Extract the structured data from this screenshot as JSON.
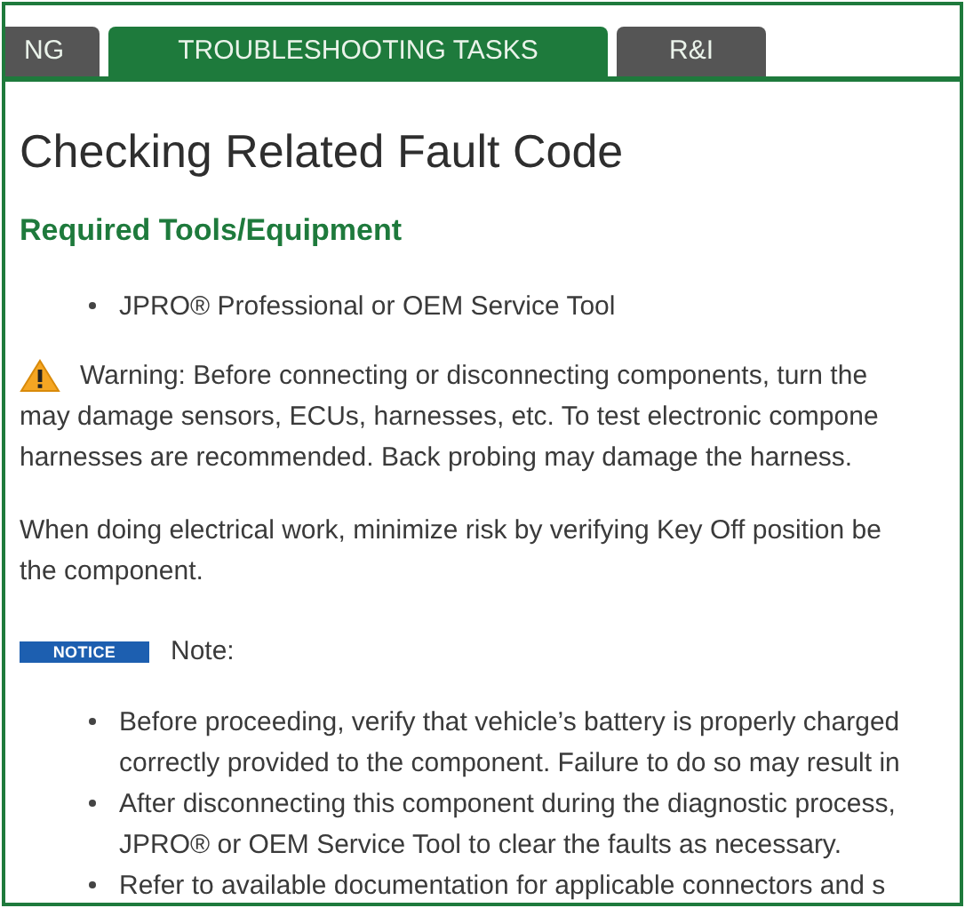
{
  "tabs": [
    {
      "label": "NG",
      "selected": false
    },
    {
      "label": "TROUBLESHOOTING TASKS",
      "selected": true
    },
    {
      "label": "R&I",
      "selected": false
    }
  ],
  "title": "Checking Related Fault Code",
  "section": {
    "heading": "Required Tools/Equipment",
    "items": [
      "JPRO® Professional or OEM Service Tool"
    ]
  },
  "warning": {
    "lines": [
      "Warning: Before connecting or disconnecting components, turn the",
      "may damage sensors, ECUs, harnesses, etc. To test electronic compone",
      "harnesses are recommended. Back probing may damage the harness."
    ]
  },
  "paragraph": {
    "lines": [
      "When doing electrical work, minimize risk by verifying Key Off position be",
      "the component."
    ]
  },
  "notice": {
    "badge": "NOTICE",
    "label": "Note:"
  },
  "notes": [
    {
      "lines": [
        "Before proceeding, verify that vehicle’s battery is properly charged",
        "correctly provided to the component. Failure to do so may result in"
      ]
    },
    {
      "lines": [
        "After disconnecting this component during the diagnostic process,",
        "JPRO® or OEM Service Tool to clear the faults as necessary."
      ]
    },
    {
      "lines": [
        "Refer to available documentation for applicable connectors and s"
      ]
    }
  ]
}
